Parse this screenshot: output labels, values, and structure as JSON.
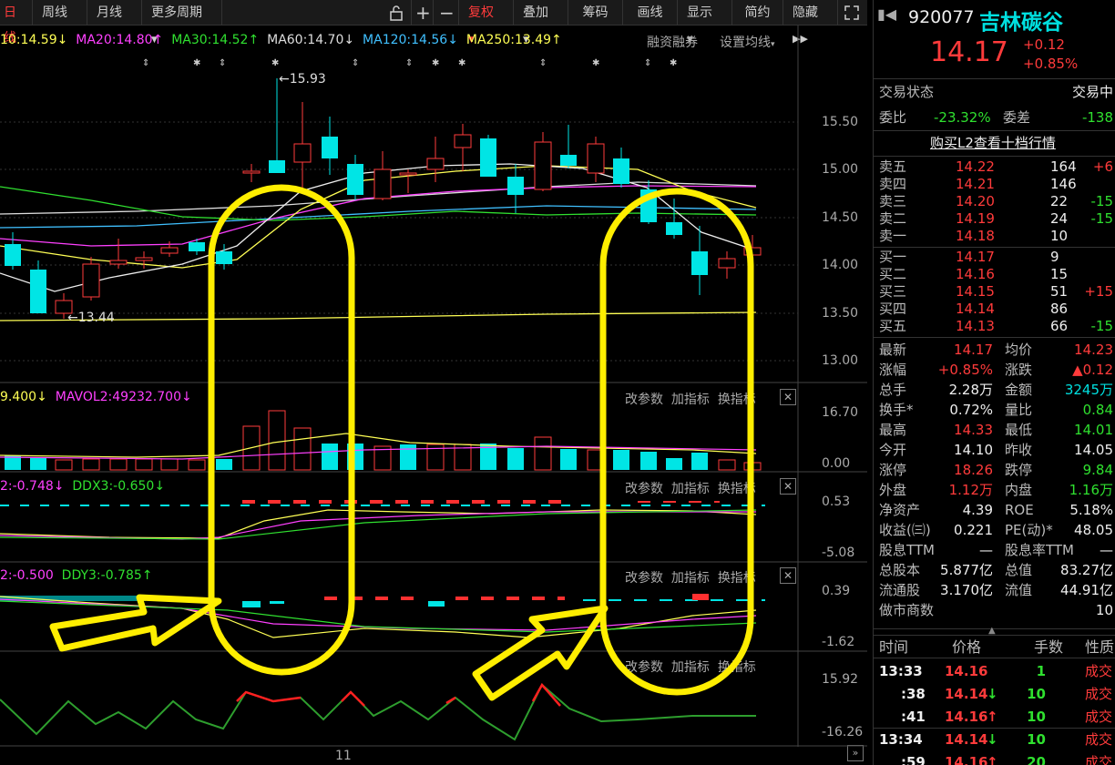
{
  "toolbar": {
    "tab_daily": "日线",
    "tab_weekly": "周线",
    "tab_monthly": "月线",
    "more_periods": "更多周期",
    "fuquan": "复权",
    "overlay": "叠加",
    "chips": "筹码",
    "draw_line": "画线",
    "display": "显示",
    "simple": "简约",
    "hide": "隐藏"
  },
  "ma_legend": {
    "ma10": "10:14.59",
    "ma20": "MA20:14.80",
    "ma30": "MA30:14.52",
    "ma60": "MA60:14.70",
    "ma120": "MA120:14.56",
    "ma250": "MA250:13.49",
    "margin": "融资融券",
    "set_ma": "设置均线"
  },
  "price_axis": [
    "15.50",
    "15.00",
    "14.50",
    "14.00",
    "13.50",
    "13.00"
  ],
  "annotations": {
    "high": "15.93",
    "low": "13.44"
  },
  "vol_legend": {
    "mavol1": "9.400",
    "mavol2": "MAVOL2:49232.700"
  },
  "vol_axis": [
    "16.70",
    "0.00"
  ],
  "ddx_legend": {
    "ddx2": "2:-0.748",
    "ddx3": "DDX3:-0.650"
  },
  "ddx_axis": [
    "0.53",
    "-5.08"
  ],
  "ddy_legend": {
    "ddy2": "2:-0.500",
    "ddy3": "DDY3:-0.785"
  },
  "ddy_axis": [
    "0.39",
    "-1.62"
  ],
  "ind4_axis": [
    "15.92",
    "-16.26"
  ],
  "panel_buttons": {
    "params": "改参数",
    "add": "加指标",
    "swap": "换指标"
  },
  "date_label": "11",
  "stock": {
    "code": "920077",
    "name": "吉林碳谷",
    "price": "14.17",
    "change": "+0.12",
    "change_pct": "+0.85%"
  },
  "status": {
    "label": "交易状态",
    "value": "交易中"
  },
  "weibi": {
    "label": "委比",
    "value": "-23.32%",
    "diff_label": "委差",
    "diff_value": "-138"
  },
  "l2_link": "购买L2查看十档行情",
  "asks": [
    {
      "label": "卖五",
      "price": "14.22",
      "vol": "164",
      "chg": "+6"
    },
    {
      "label": "卖四",
      "price": "14.21",
      "vol": "146",
      "chg": ""
    },
    {
      "label": "卖三",
      "price": "14.20",
      "vol": "22",
      "chg": "-15"
    },
    {
      "label": "卖二",
      "price": "14.19",
      "vol": "24",
      "chg": "-15"
    },
    {
      "label": "卖一",
      "price": "14.18",
      "vol": "10",
      "chg": ""
    }
  ],
  "bids": [
    {
      "label": "买一",
      "price": "14.17",
      "vol": "9",
      "chg": ""
    },
    {
      "label": "买二",
      "price": "14.16",
      "vol": "15",
      "chg": ""
    },
    {
      "label": "买三",
      "price": "14.15",
      "vol": "51",
      "chg": "+15"
    },
    {
      "label": "买四",
      "price": "14.14",
      "vol": "86",
      "chg": ""
    },
    {
      "label": "买五",
      "price": "14.13",
      "vol": "66",
      "chg": "-15"
    }
  ],
  "stats": [
    {
      "l1": "最新",
      "v1": "14.17",
      "l2": "均价",
      "v2": "14.23"
    },
    {
      "l1": "涨幅",
      "v1": "+0.85%",
      "l2": "涨跌",
      "v2": "▲0.12"
    },
    {
      "l1": "总手",
      "v1": "2.28万",
      "l2": "金额",
      "v2": "3245万"
    },
    {
      "l1": "换手*",
      "v1": "0.72%",
      "l2": "量比",
      "v2": "0.84"
    },
    {
      "l1": "最高",
      "v1": "14.33",
      "l2": "最低",
      "v2": "14.01"
    },
    {
      "l1": "今开",
      "v1": "14.10",
      "l2": "昨收",
      "v2": "14.05"
    },
    {
      "l1": "涨停",
      "v1": "18.26",
      "l2": "跌停",
      "v2": "9.84"
    },
    {
      "l1": "外盘",
      "v1": "1.12万",
      "l2": "内盘",
      "v2": "1.16万"
    },
    {
      "l1": "净资产",
      "v1": "4.39",
      "l2": "ROE",
      "v2": "5.18%"
    },
    {
      "l1": "收益(㈢)",
      "v1": "0.221",
      "l2": "PE(动)*",
      "v2": "48.05"
    },
    {
      "l1": "股息TTM",
      "v1": "—",
      "l2": "股息率TTM",
      "v2": "—"
    },
    {
      "l1": "总股本",
      "v1": "5.877亿",
      "l2": "总值",
      "v2": "83.27亿"
    },
    {
      "l1": "流通股",
      "v1": "3.170亿",
      "l2": "流值",
      "v2": "44.91亿"
    },
    {
      "l1": "做市商数",
      "v1": "",
      "l2": "",
      "v2": "10"
    }
  ],
  "trades_header": {
    "time": "时间",
    "price": "价格",
    "vol": "手数",
    "nature": "性质"
  },
  "trades": [
    {
      "time": "13:33",
      "price": "14.16",
      "arrow": "",
      "vol": "1",
      "nature": "成交"
    },
    {
      "time": ":38",
      "price": "14.14",
      "arrow": "↓",
      "vol": "10",
      "nature": "成交"
    },
    {
      "time": ":41",
      "price": "14.16",
      "arrow": "↑",
      "vol": "10",
      "nature": "成交"
    },
    {
      "time": "13:34",
      "price": "14.14",
      "arrow": "↓",
      "vol": "10",
      "nature": "成交"
    },
    {
      "time": ":59",
      "price": "14.16",
      "arrow": "↑",
      "vol": "20",
      "nature": "成交"
    }
  ],
  "colors": {
    "up": "#ff3b3b",
    "down": "#00e5e5",
    "ma_yellow": "#ffff55",
    "ma_magenta": "#ff40ff",
    "ma_green": "#30e030",
    "ma_cyan": "#40c0ff",
    "highlight": "#ffee00"
  }
}
